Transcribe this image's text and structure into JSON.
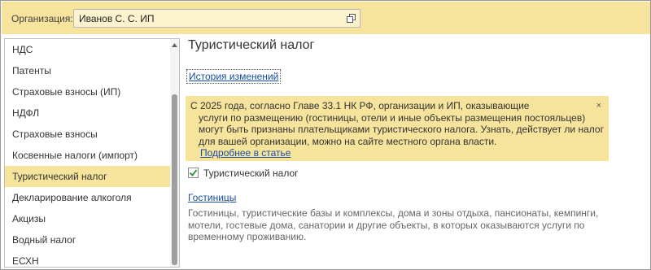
{
  "organization": {
    "label": "Организация:",
    "value": "Иванов С. С. ИП",
    "open_icon": "open-form-icon"
  },
  "sidebar": {
    "items": [
      {
        "label": "НДС",
        "active": false
      },
      {
        "label": "Патенты",
        "active": false
      },
      {
        "label": "Страховые взносы (ИП)",
        "active": false
      },
      {
        "label": "НДФЛ",
        "active": false
      },
      {
        "label": "Страховые взносы",
        "active": false
      },
      {
        "label": "Косвенные налоги (импорт)",
        "active": false
      },
      {
        "label": "Туристический налог",
        "active": true
      },
      {
        "label": "Декларирование алкоголя",
        "active": false
      },
      {
        "label": "Акцизы",
        "active": false
      },
      {
        "label": "Водный налог",
        "active": false
      },
      {
        "label": "ЕСХН",
        "active": false
      }
    ]
  },
  "main": {
    "title": "Туристический налог",
    "history_link": "История изменений",
    "notice": {
      "lines": [
        "С 2025 года, согласно Главе 33.1 НК РФ, организации и ИП, оказывающие",
        "услуги по размещению (гостиницы, отели и иные объекты размещения постояльцев)",
        "могут быть признаны плательщиками туристического налога. Узнать, действует ли налог",
        "для вашей организации, можно на сайте местного органа власти."
      ],
      "link": "Подробнее в статье",
      "close": "×"
    },
    "checkbox": {
      "label": "Туристический налог",
      "checked": true
    },
    "hotels": {
      "link": "Гостиницы",
      "description_lines": [
        "Гостиницы, туристические базы и комплексы, дома и зоны отдыха, пансионаты, кемпинги,",
        "мотели, гостевые дома, санатории и другие объекты, в которых оказываются услуги по",
        "временному проживанию."
      ]
    }
  },
  "colors": {
    "accent_yellow": "#f6e39c",
    "link_blue": "#1a4ea0",
    "checkbox_green": "#2e8b2e"
  }
}
